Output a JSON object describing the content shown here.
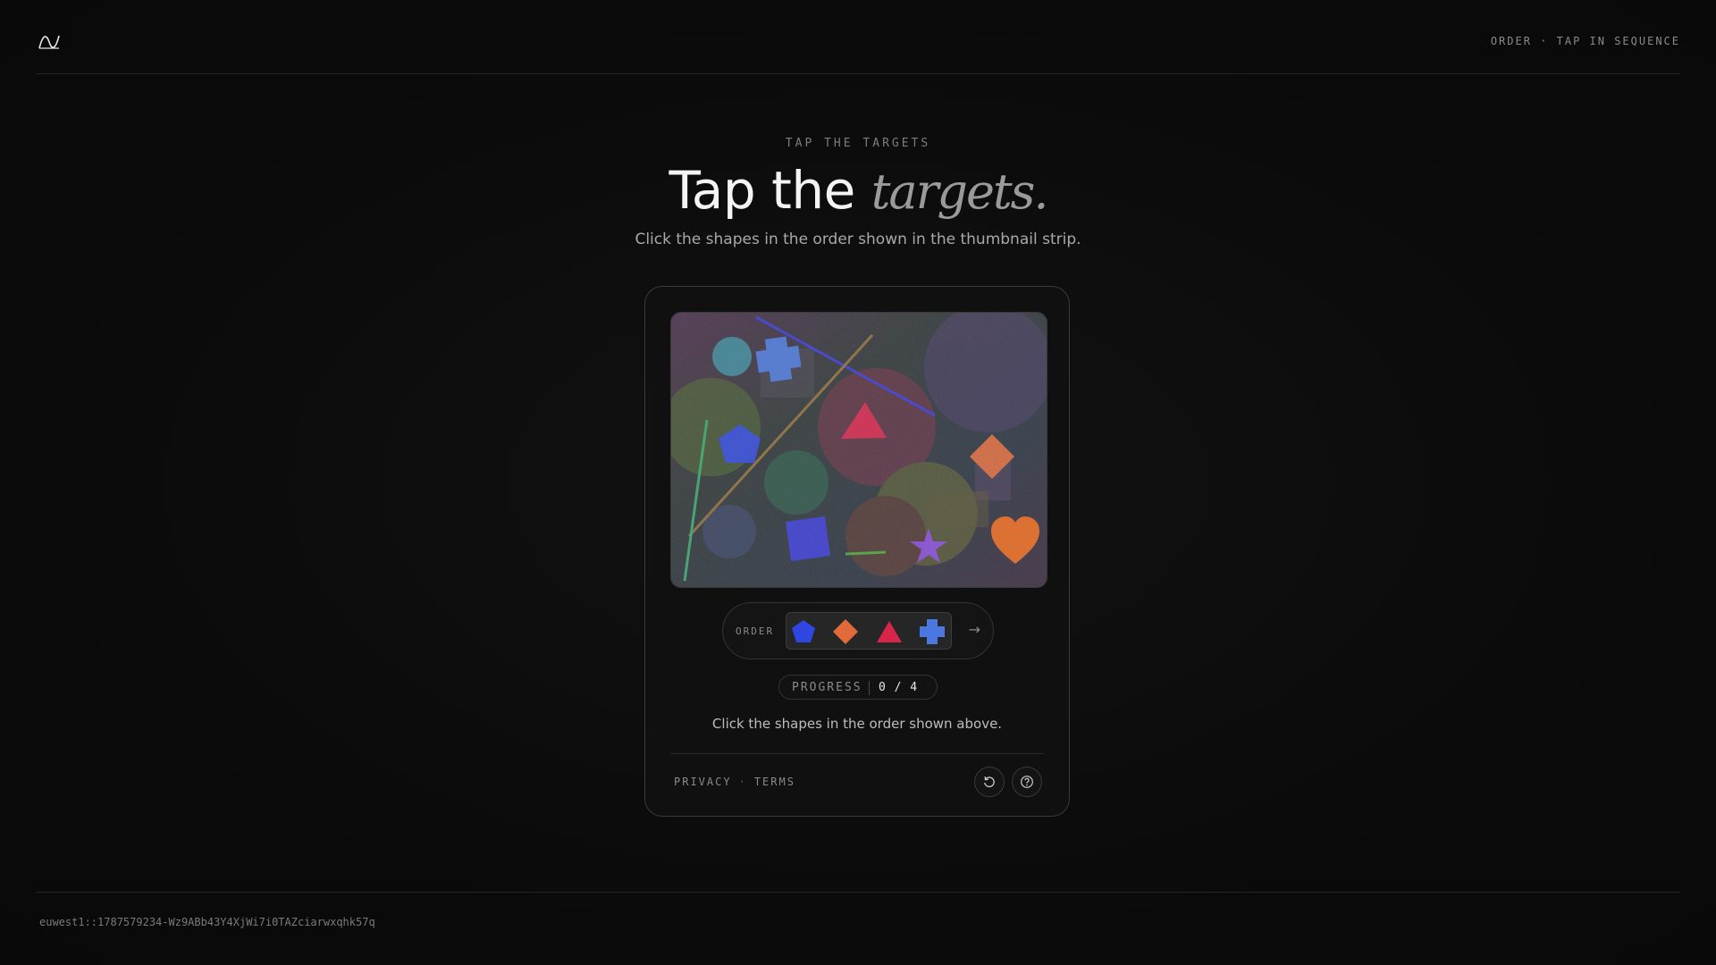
{
  "header": {
    "mode_label": "ORDER · TAP IN SEQUENCE"
  },
  "hero": {
    "eyebrow": "TAP THE TARGETS",
    "title_main": "Tap the ",
    "title_emphasis": "targets.",
    "subtitle": "Click the shapes in the order shown in the thumbnail strip."
  },
  "challenge": {
    "scene": {
      "shapes": [
        {
          "name": "circle-teal",
          "kind": "circle",
          "color": "#3a93a6"
        },
        {
          "name": "cross-blue",
          "kind": "cross",
          "color": "#4a78e0"
        },
        {
          "name": "pentagon-blue",
          "kind": "pentagon",
          "color": "#2f46e0"
        },
        {
          "name": "triangle-red",
          "kind": "triangle",
          "color": "#d8254a"
        },
        {
          "name": "diamond-orange",
          "kind": "diamond",
          "color": "#e06a3a"
        },
        {
          "name": "square-blue",
          "kind": "square",
          "color": "#3a3ad8"
        },
        {
          "name": "star-purple",
          "kind": "star",
          "color": "#8a4ae0"
        },
        {
          "name": "heart-orange",
          "kind": "heart",
          "color": "#f06a1a"
        }
      ]
    },
    "order": {
      "label": "ORDER",
      "sequence": [
        {
          "name": "pentagon",
          "color": "#2f46e0"
        },
        {
          "name": "diamond",
          "color": "#e06a3a"
        },
        {
          "name": "triangle",
          "color": "#d8254a"
        },
        {
          "name": "cross",
          "color": "#4a78e0"
        }
      ],
      "arrow": "→"
    },
    "progress": {
      "label": "PROGRESS",
      "value": "0 / 4"
    },
    "instruction": "Click the shapes in the order shown above.",
    "links": {
      "privacy": "PRIVACY",
      "separator": "·",
      "terms": "TERMS"
    },
    "icons": {
      "reload": "reload-icon",
      "help": "help-icon"
    }
  },
  "footer": {
    "session_id": "euwest1::1787579234-Wz9ABb43Y4XjWi7i0TAZciarwxqhk57q"
  }
}
